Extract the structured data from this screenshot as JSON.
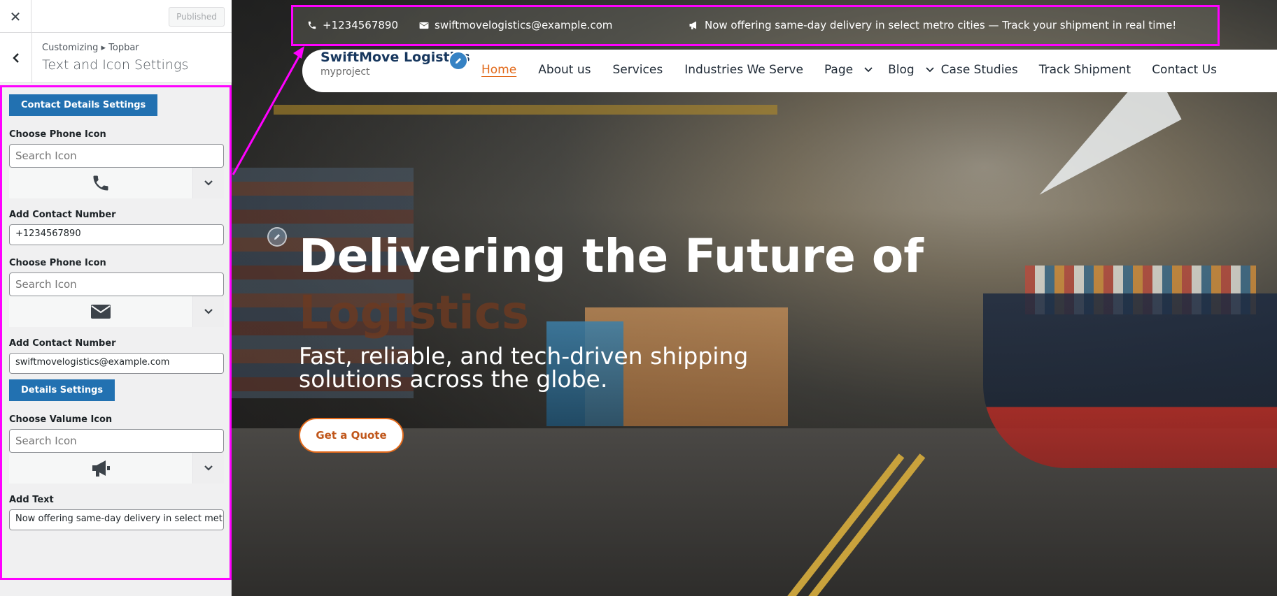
{
  "customizer": {
    "close_icon": "close-icon",
    "publish_label": "Published",
    "breadcrumb": "Customizing ▸ Topbar",
    "section_title": "Text and Icon Settings",
    "contact_section_label": "Contact Details Settings",
    "phone_icon_label": "Choose Phone Icon",
    "phone_icon_search_placeholder": "Search Icon",
    "phone_icon_preview": "phone-icon",
    "contact_number_label": "Add Contact Number",
    "contact_number_value": "+1234567890",
    "email_icon_label": "Choose Phone Icon",
    "email_icon_search_placeholder": "Search Icon",
    "email_icon_preview": "envelope-icon",
    "email_label": "Add Contact Number",
    "email_value": "swiftmovelogistics@example.com",
    "details_section_label": "Details Settings",
    "volume_icon_label": "Choose Valume Icon",
    "volume_icon_search_placeholder": "Search Icon",
    "volume_icon_preview": "megaphone-icon",
    "add_text_label": "Add Text",
    "add_text_value": "Now offering same-day delivery in select metro cities — Track your shipment in real time!"
  },
  "preview": {
    "topbar": {
      "phone": "+1234567890",
      "email": "swiftmovelogistics@example.com",
      "announcement": "Now offering same-day delivery in select metro cities — Track your shipment in real time!"
    },
    "site": {
      "title": "SwiftMove Logistics",
      "tagline": "myproject"
    },
    "nav": [
      {
        "label": "Home",
        "active": true
      },
      {
        "label": "About us"
      },
      {
        "label": "Services"
      },
      {
        "label": "Industries We Serve"
      },
      {
        "label": "Page",
        "dropdown": true
      },
      {
        "label": "Blog",
        "dropdown": true
      },
      {
        "label": "Case Studies"
      },
      {
        "label": "Track Shipment"
      },
      {
        "label": "Contact Us"
      }
    ],
    "hero": {
      "heading_line1": "Delivering the Future of",
      "heading_line2": "Logistics",
      "subheading": "Fast, reliable, and tech-driven shipping solutions across the globe.",
      "cta_label": "Get a Quote"
    }
  },
  "colors": {
    "accent": "#2271b1",
    "highlight": "#ff00ff",
    "nav_active": "#e26a1b",
    "brand_title": "#17375e"
  }
}
